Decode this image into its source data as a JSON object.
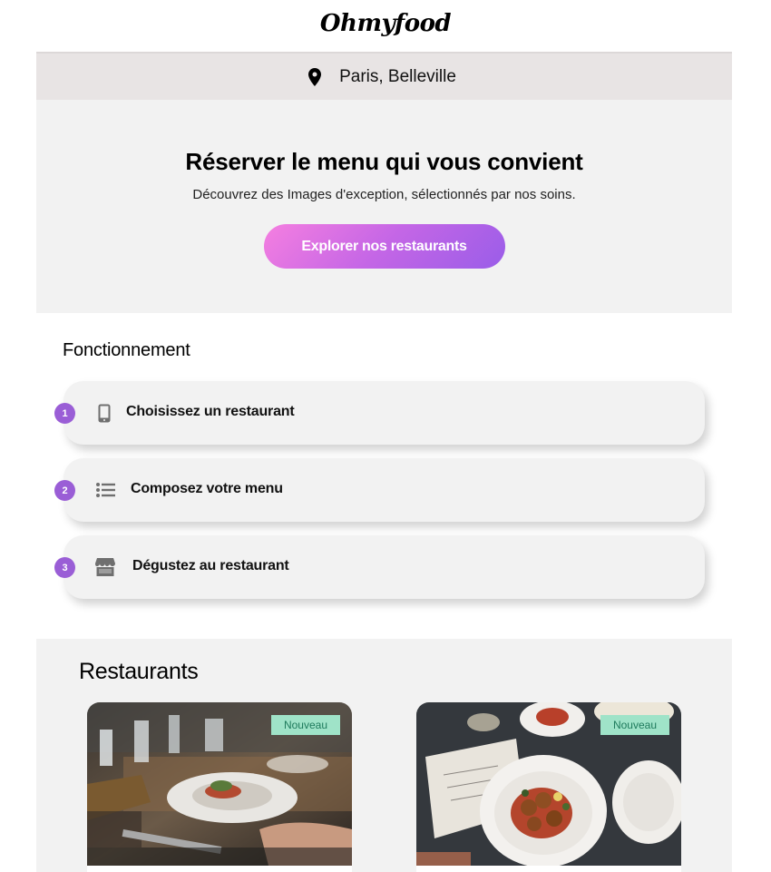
{
  "header": {
    "logo": "Ohmyfood"
  },
  "location": {
    "icon": "map-pin-icon",
    "text": "Paris, Belleville"
  },
  "hero": {
    "title": "Réserver le menu qui vous convient",
    "subtitle": "Découvrez des Images d'exception, sélectionnés par nos soins.",
    "cta_label": "Explorer nos restaurants"
  },
  "how": {
    "title": "Fonctionnement",
    "steps": [
      {
        "number": "1",
        "icon": "smartphone-icon",
        "label": "Choisissez un restaurant"
      },
      {
        "number": "2",
        "icon": "list-icon",
        "label": "Composez votre menu"
      },
      {
        "number": "3",
        "icon": "store-icon",
        "label": "Dégustez au restaurant"
      }
    ]
  },
  "restaurants": {
    "title": "Restaurants",
    "cards": [
      {
        "badge": "Nouveau"
      },
      {
        "badge": "Nouveau"
      }
    ]
  },
  "colors": {
    "accent_purple": "#9a5ed6",
    "gradient_start": "#f57fe0",
    "gradient_end": "#9a5de8",
    "badge_bg": "#9fe3c8",
    "badge_text": "#1e7a5c"
  }
}
